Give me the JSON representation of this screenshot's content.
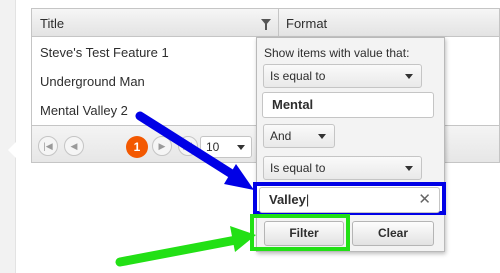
{
  "grid": {
    "columns": {
      "title": "Title",
      "format": "Format"
    },
    "rows": [
      {
        "title": "Steve's Test Feature 1"
      },
      {
        "title": "Underground Man"
      },
      {
        "title": "Mental Valley 2"
      }
    ],
    "pager": {
      "first_icon": "first-page-icon",
      "prev_icon": "prev-page-icon",
      "current_page": "1",
      "next_icon": "next-page-icon",
      "last_icon": "last-page-icon",
      "page_size": "10"
    }
  },
  "filter_popup": {
    "help_text": "Show items with value that:",
    "operator1": "Is equal to",
    "value1": "Mental",
    "logic": "And",
    "operator2": "Is equal to",
    "value2": "Valley",
    "filter_label": "Filter",
    "clear_label": "Clear"
  },
  "annotations": {
    "blue_color": "#0000e6",
    "green_color": "#22e015"
  }
}
